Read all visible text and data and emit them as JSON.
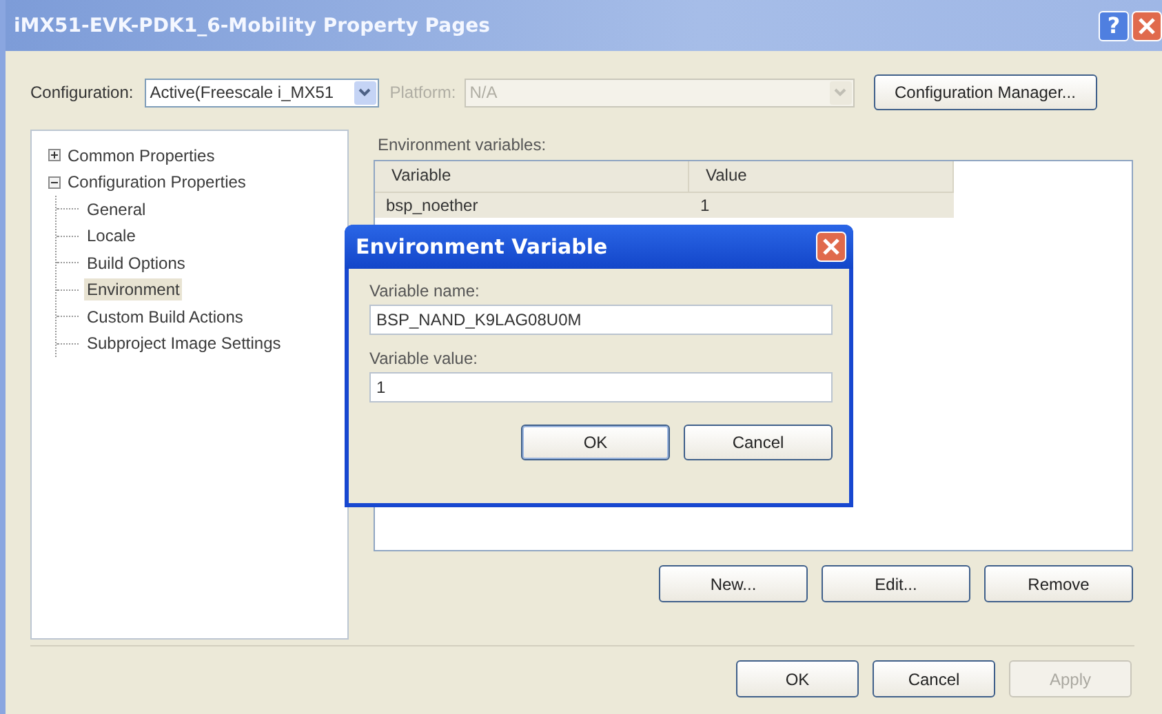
{
  "window": {
    "title": "iMX51-EVK-PDK1_6-Mobility Property Pages",
    "help": "?"
  },
  "configuration": {
    "label": "Configuration:",
    "value": "Active(Freescale i_MX51",
    "disabled": false
  },
  "platform": {
    "label": "Platform:",
    "value": "N/A",
    "disabled": true
  },
  "configuration_manager": "Configuration Manager...",
  "tree": [
    {
      "label": "Common Properties",
      "expanded": false,
      "selected": false
    },
    {
      "label": "Configuration Properties",
      "expanded": true,
      "selected": false,
      "children": [
        {
          "label": "General",
          "selected": false
        },
        {
          "label": "Locale",
          "selected": false
        },
        {
          "label": "Build Options",
          "selected": false
        },
        {
          "label": "Environment",
          "selected": true
        },
        {
          "label": "Custom Build Actions",
          "selected": false
        },
        {
          "label": "Subproject Image Settings",
          "selected": false
        }
      ]
    }
  ],
  "environment": {
    "label": "Environment variables:",
    "columns": [
      "Variable",
      "Value"
    ],
    "rows": [
      {
        "variable": "bsp_noether",
        "value": "1"
      }
    ]
  },
  "list_buttons": [
    {
      "label": "New...",
      "disabled": false
    },
    {
      "label": "Edit...",
      "disabled": false
    },
    {
      "label": "Remove",
      "disabled": false
    }
  ],
  "footer_buttons": [
    {
      "label": "OK",
      "disabled": false
    },
    {
      "label": "Cancel",
      "disabled": false
    },
    {
      "label": "Apply",
      "disabled": true
    }
  ],
  "dialog": {
    "title": "Environment Variable",
    "name_label": "Variable name:",
    "name_value": "BSP_NAND_K9LAG08U0M",
    "value_label": "Variable value:",
    "value_value": "1",
    "buttons": [
      {
        "label": "OK",
        "disabled": false,
        "default": true
      },
      {
        "label": "Cancel",
        "disabled": false,
        "default": false
      }
    ]
  }
}
